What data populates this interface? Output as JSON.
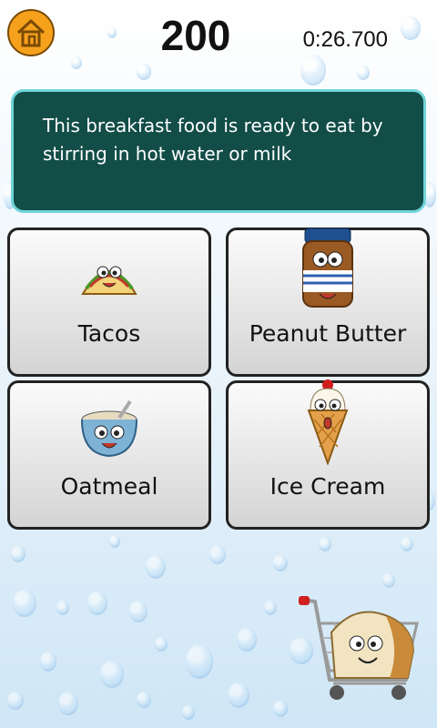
{
  "header": {
    "score": "200",
    "timer": "0:26.700"
  },
  "question": {
    "text": "This breakfast food is ready to eat by stirring in hot water or milk"
  },
  "answers": [
    {
      "label": "Tacos",
      "icon": "taco-icon"
    },
    {
      "label": "Peanut Butter",
      "icon": "peanut-butter-jar-icon"
    },
    {
      "label": "Oatmeal",
      "icon": "oatmeal-bowl-icon"
    },
    {
      "label": "Ice Cream",
      "icon": "ice-cream-cone-icon"
    }
  ],
  "colors": {
    "home_button": "#f6a11c",
    "question_bg": "#124d48",
    "question_border": "#6fd4d8"
  }
}
